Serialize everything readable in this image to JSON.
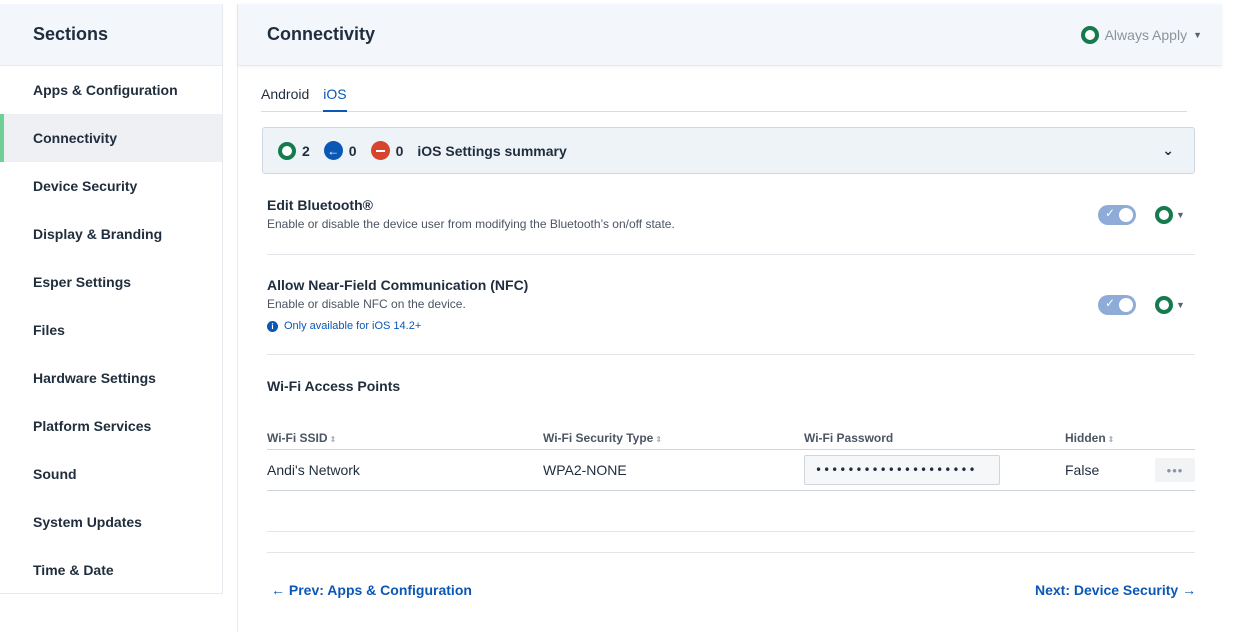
{
  "sidebar": {
    "title": "Sections",
    "items": [
      {
        "label": "Apps & Configuration"
      },
      {
        "label": "Connectivity"
      },
      {
        "label": "Device Security"
      },
      {
        "label": "Display & Branding"
      },
      {
        "label": "Esper Settings"
      },
      {
        "label": "Files"
      },
      {
        "label": "Hardware Settings"
      },
      {
        "label": "Platform Services"
      },
      {
        "label": "Sound"
      },
      {
        "label": "System Updates"
      },
      {
        "label": "Time & Date"
      }
    ],
    "active_item": "Connectivity"
  },
  "main": {
    "title": "Connectivity",
    "apply_mode": "Always Apply",
    "tabs": [
      {
        "label": "Android"
      },
      {
        "label": "iOS"
      }
    ],
    "active_tab": "iOS",
    "summary": {
      "applied_count": "2",
      "pending_count": "0",
      "blocked_count": "0",
      "label": "iOS Settings summary"
    },
    "settings": [
      {
        "title": "Edit Bluetooth®",
        "description": "Enable or disable the device user from modifying the Bluetooth’s on/off state.",
        "enabled": true
      },
      {
        "title": "Allow Near-Field Communication (NFC)",
        "description": "Enable or disable NFC on the device.",
        "note": "Only available for iOS 14.2+",
        "enabled": true
      }
    ],
    "wifi": {
      "title": "Wi-Fi Access Points",
      "columns": [
        "Wi-Fi SSID",
        "Wi-Fi Security Type",
        "Wi-Fi Password",
        "Hidden"
      ],
      "rows": [
        {
          "ssid": "Andi's Network",
          "security": "WPA2-NONE",
          "password": "••••••••••••••••••••",
          "hidden": "False"
        }
      ]
    },
    "nav": {
      "prev": "← Prev: Apps & Configuration",
      "next": "Next: Device Security →"
    }
  },
  "colors": {
    "accent_blue": "#0b57b5",
    "applied_green": "#157a4d",
    "blocked_red": "#d6452b",
    "active_indicator": "#6fcf97",
    "toggle_on": "#8fabd8"
  }
}
